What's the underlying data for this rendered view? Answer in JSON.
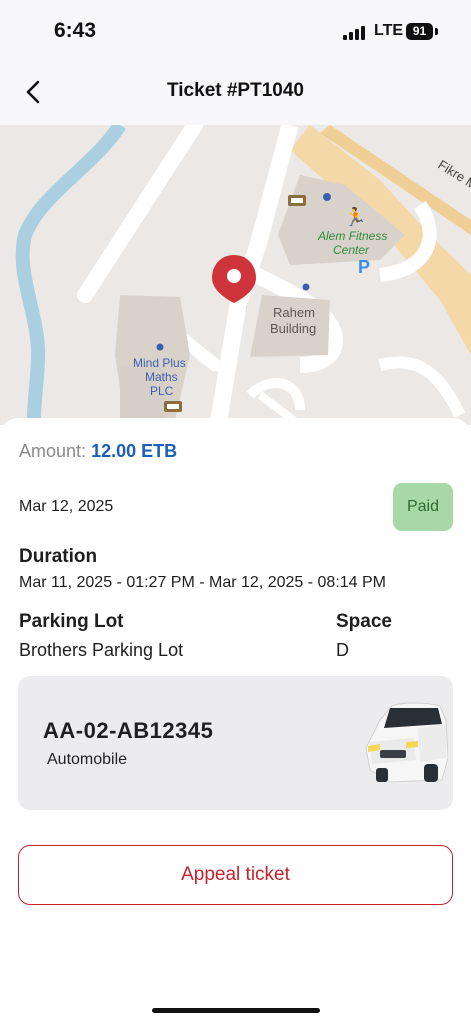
{
  "status_bar": {
    "time": "6:43",
    "network": "LTE",
    "battery": "91"
  },
  "header": {
    "title": "Ticket #PT1040",
    "back_icon": "chevron-left-icon"
  },
  "map": {
    "labels": {
      "street": "Fikre M",
      "fitness": [
        "Alem Fitness",
        "Center"
      ],
      "rahem": [
        "Rahem",
        "Building"
      ],
      "mindplus": [
        "Mind Plus",
        "Maths",
        "PLC"
      ],
      "parking": "P"
    },
    "pin_color": "#d0343b"
  },
  "ticket": {
    "amount_label": "Amount:",
    "amount_value": "12.00 ETB",
    "date": "Mar 12, 2025",
    "status": "Paid",
    "duration_label": "Duration",
    "duration_value": "Mar 11, 2025 - 01:27 PM - Mar 12, 2025 - 08:14 PM",
    "parking_lot_label": "Parking Lot",
    "parking_lot_value": "Brothers Parking Lot",
    "space_label": "Space",
    "space_value": "D"
  },
  "vehicle": {
    "plate": "AA-02-AB12345",
    "type": "Automobile",
    "icon": "car-icon"
  },
  "actions": {
    "appeal_label": "Appeal ticket"
  },
  "colors": {
    "accent_red": "#c5222c",
    "amount_blue": "#1c5fb8",
    "paid_bg": "#a9d8a8"
  }
}
